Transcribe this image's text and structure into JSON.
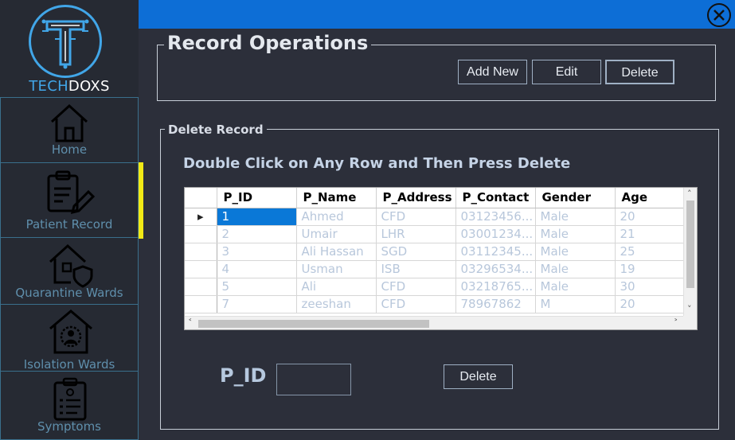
{
  "brand": {
    "part1": "TECH",
    "part2": "DOXS"
  },
  "sidebar": {
    "items": [
      {
        "label": "Home"
      },
      {
        "label": "Patient Record"
      },
      {
        "label": "Quarantine Wards"
      },
      {
        "label": "Isolation Wards"
      },
      {
        "label": "Symptoms"
      }
    ],
    "active_color": "#f1ea16"
  },
  "colors": {
    "topbar": "#0d6ed6",
    "selection": "#0a78d7",
    "accent": "#41a6e8"
  },
  "record_ops": {
    "title": "Record Operations",
    "buttons": {
      "add_new": "Add New",
      "edit": "Edit",
      "delete": "Delete"
    }
  },
  "delete_record": {
    "title": "Delete Record",
    "instruction": "Double Click on Any Row and Then Press Delete",
    "grid": {
      "columns": [
        "P_ID",
        "P_Name",
        "P_Address",
        "P_Contact",
        "Gender",
        "Age"
      ],
      "rows": [
        [
          "1",
          "Ahmed",
          "CFD",
          "03123456...",
          "Male",
          "20"
        ],
        [
          "2",
          "Umair",
          "LHR",
          "03001234...",
          "Male",
          "21"
        ],
        [
          "3",
          "Ali Hassan",
          "SGD",
          "03112345...",
          "Male",
          "25"
        ],
        [
          "4",
          "Usman",
          "ISB",
          "03296534...",
          "Male",
          "19"
        ],
        [
          "5",
          "Ali",
          "CFD",
          "03218765...",
          "Male",
          "30"
        ],
        [
          "7",
          "zeeshan",
          "CFD",
          "78967862",
          "M",
          "20"
        ]
      ]
    },
    "pid_label": "P_ID",
    "pid_value": "",
    "delete_button": "Delete"
  }
}
